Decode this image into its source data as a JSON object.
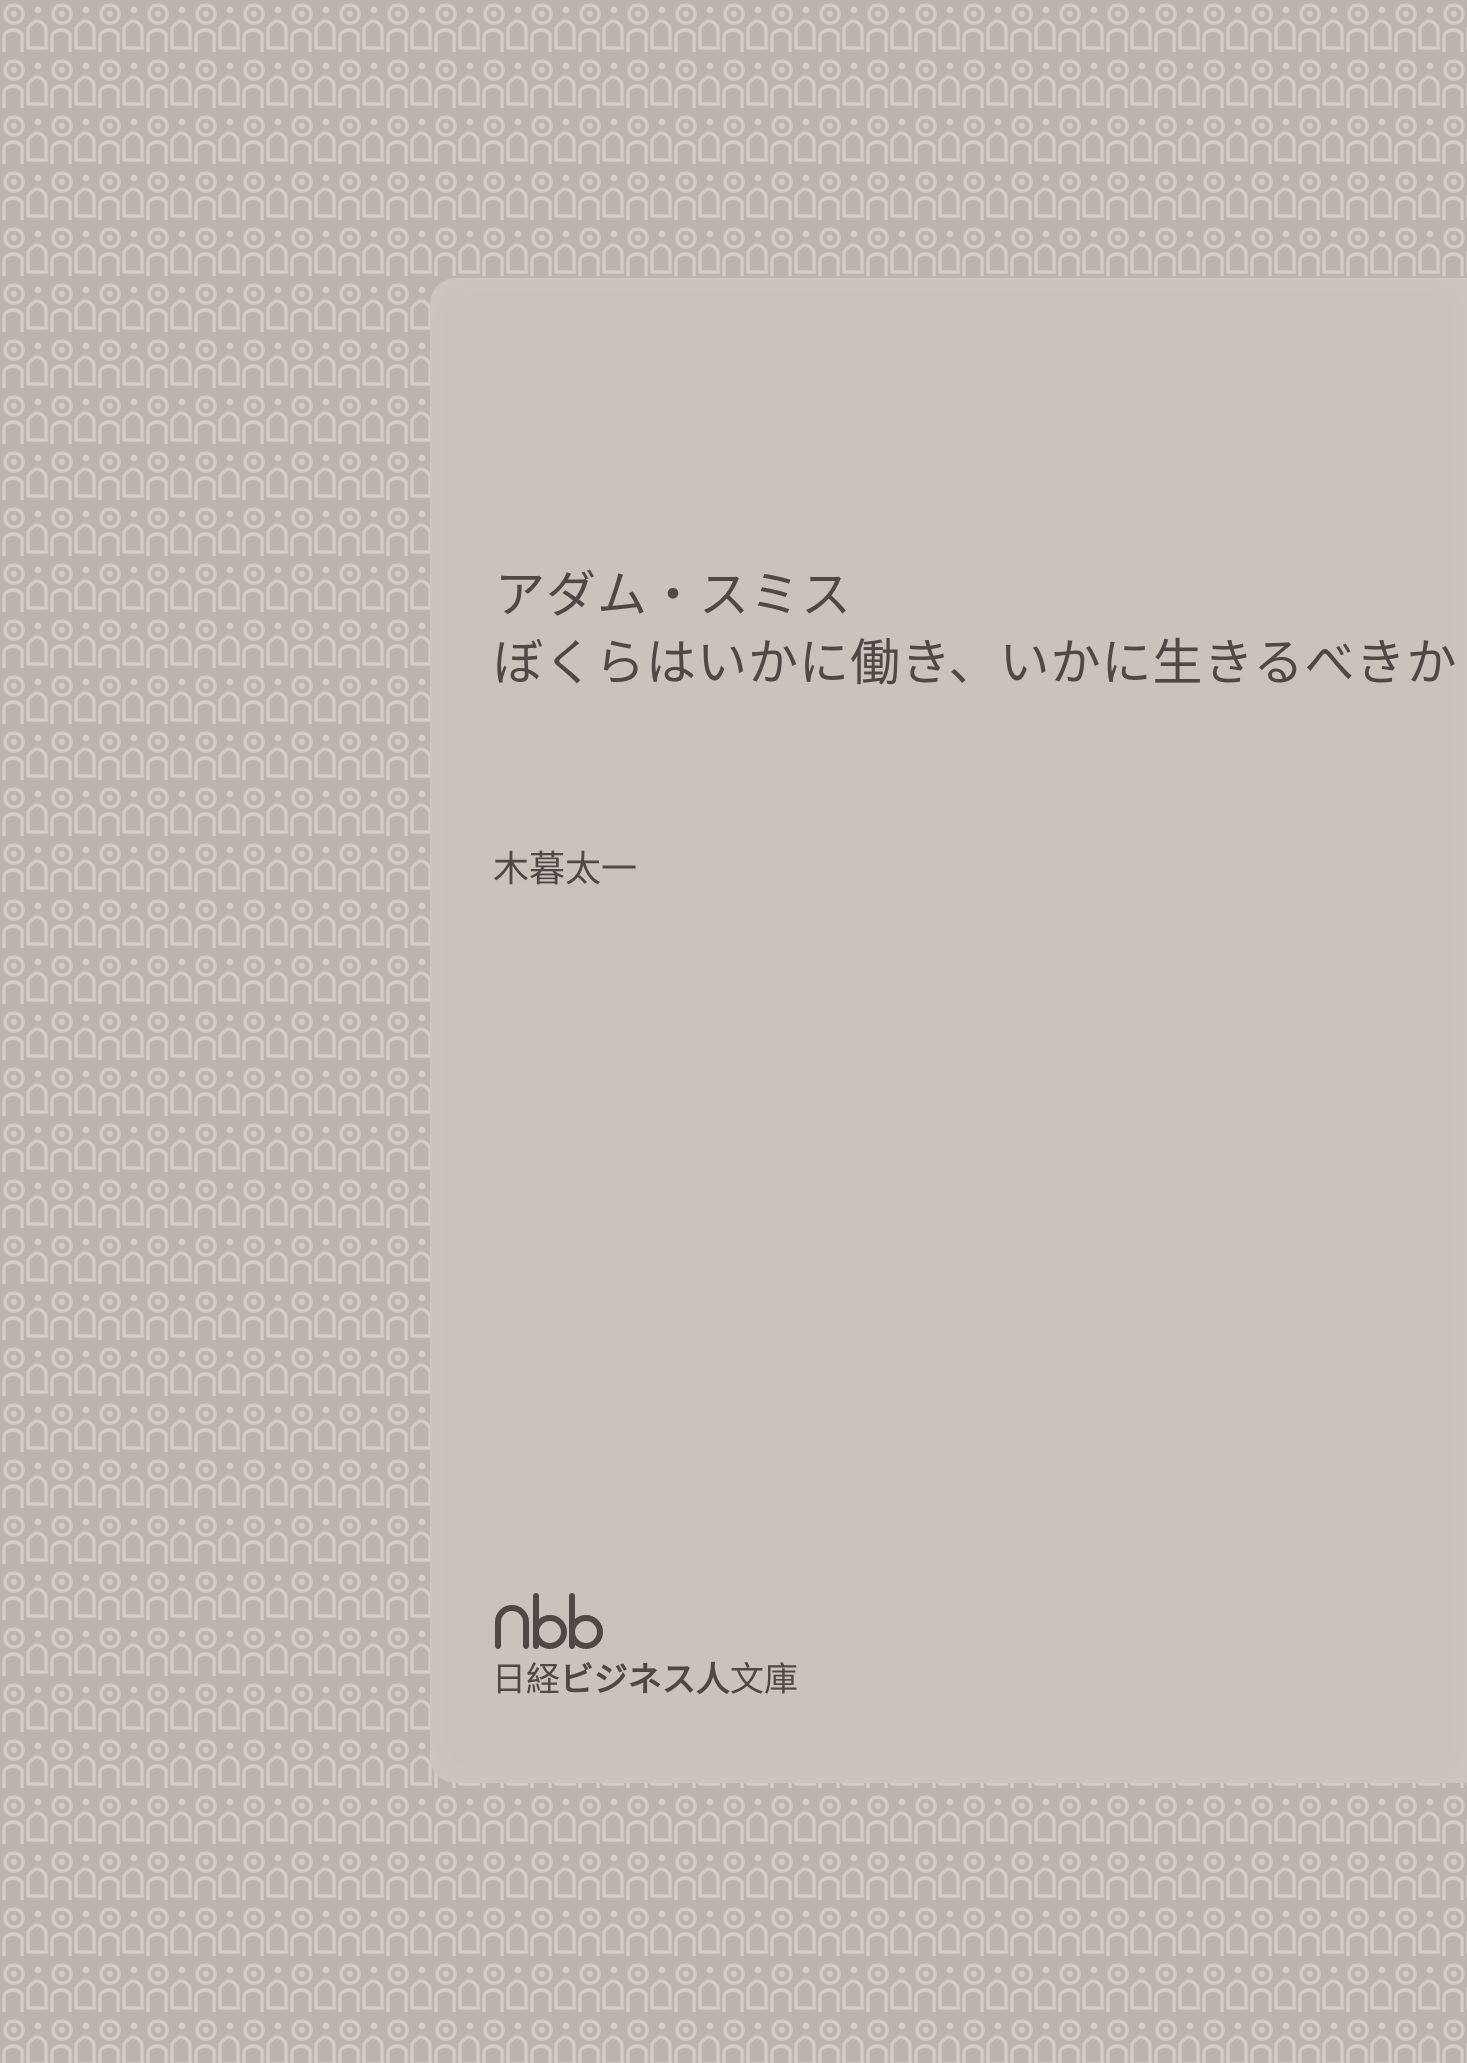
{
  "cover": {
    "title_line1": "アダム・スミス",
    "title_line2": "ぼくらはいかに働き、いかに生きるべきか",
    "author": "木暮太一",
    "publisher_logo": "nbb",
    "imprint_prefix": "日経",
    "imprint_bold": "ビジネス人",
    "imprint_suffix": "文庫"
  },
  "colors": {
    "background": "#bbb4ad",
    "panel": "#c9c3bc",
    "pattern": "#d3cdc6",
    "text": "#4f4945"
  }
}
